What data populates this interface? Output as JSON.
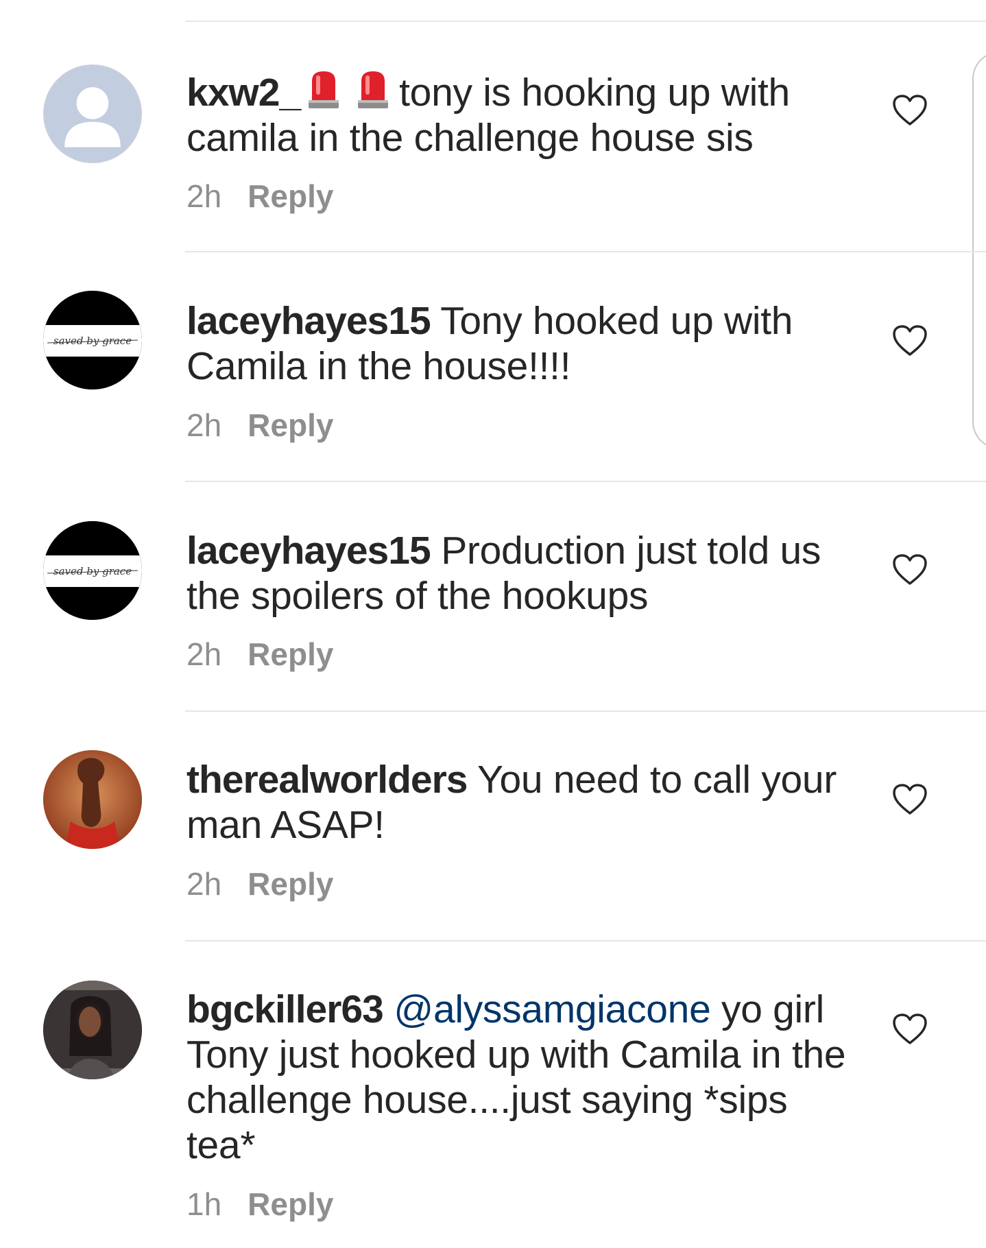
{
  "comments": [
    {
      "username": "kxw2_",
      "emojis": [
        "rotating-light-icon",
        "rotating-light-icon"
      ],
      "text": "tony is hooking up with camila in the challenge house sis",
      "time": "2h",
      "reply_label": "Reply",
      "avatar": "default-avatar-icon"
    },
    {
      "username": "laceyhayes15",
      "text": "Tony hooked up with Camila in the house!!!!",
      "time": "2h",
      "reply_label": "Reply",
      "avatar": "saved-by-grace-logo",
      "avatar_text": "saved by grace"
    },
    {
      "username": "laceyhayes15",
      "text": "Production just told us the spoilers of the hookups",
      "time": "2h",
      "reply_label": "Reply",
      "avatar": "saved-by-grace-logo",
      "avatar_text": "saved by grace"
    },
    {
      "username": "therealworlders",
      "text": "You need to call your man ASAP!",
      "time": "2h",
      "reply_label": "Reply",
      "avatar": "profile-photo"
    },
    {
      "username": "bgckiller63",
      "mention": "@alyssamgiacone",
      "text": "yo girl Tony just hooked up with Camila in the challenge house....just saying *sips tea*",
      "time": "1h",
      "reply_label": "Reply",
      "avatar": "profile-photo"
    }
  ],
  "colors": {
    "text": "#262626",
    "meta": "#8e8e8e",
    "mention": "#003569",
    "divider": "#e6e6e6"
  }
}
